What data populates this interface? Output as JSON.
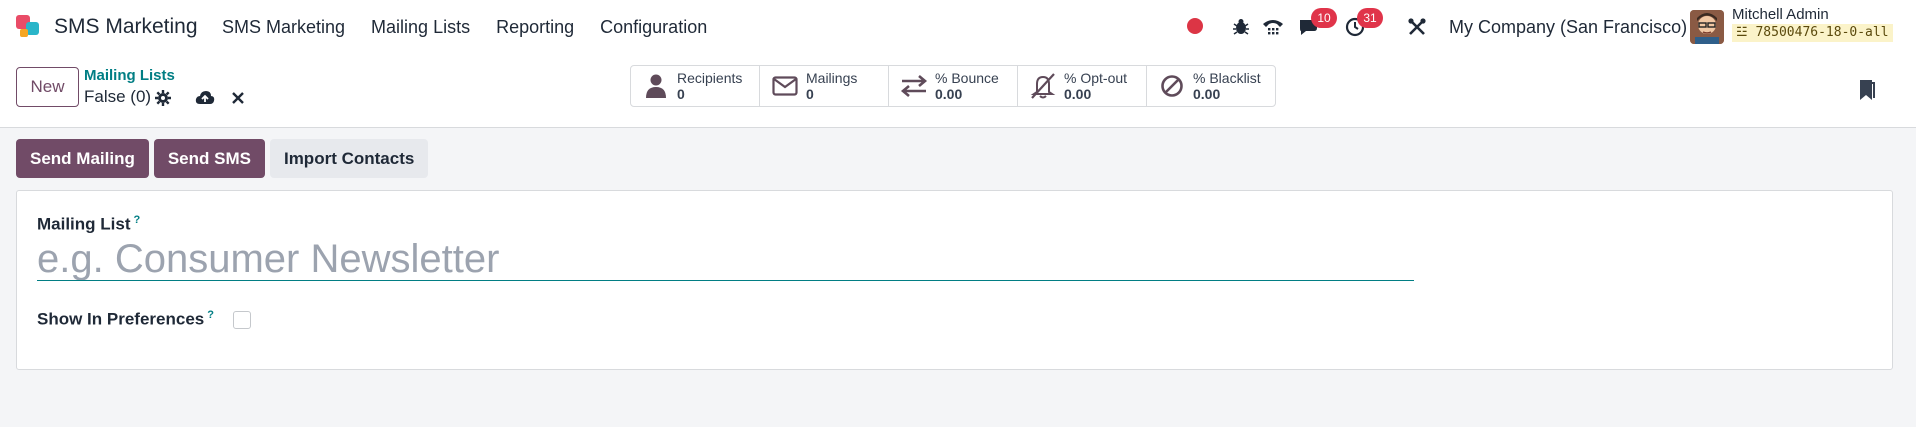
{
  "navbar": {
    "app_name": "SMS Marketing",
    "menu": [
      "SMS Marketing",
      "Mailing Lists",
      "Reporting",
      "Configuration"
    ],
    "chat_badge": "10",
    "activity_badge": "31",
    "company": "My Company (San Francisco)",
    "user_name": "Mitchell Admin",
    "db_name": "78500476-18-0-all",
    "record_color": "#dc3545"
  },
  "control": {
    "new_label": "New",
    "breadcrumb": "Mailing Lists",
    "record_name": "False (0)"
  },
  "stats": [
    {
      "label": "Recipients",
      "value": "0",
      "icon": "user-icon"
    },
    {
      "label": "Mailings",
      "value": "0",
      "icon": "envelope-icon"
    },
    {
      "label": "% Bounce",
      "value": "0.00",
      "icon": "exchange-icon"
    },
    {
      "label": "% Opt-out",
      "value": "0.00",
      "icon": "bell-slash-icon"
    },
    {
      "label": "% Blacklist",
      "value": "0.00",
      "icon": "ban-icon"
    }
  ],
  "actions": {
    "send_mailing": "Send Mailing",
    "send_sms": "Send SMS",
    "import_contacts": "Import Contacts"
  },
  "form": {
    "mailing_list_label": "Mailing List",
    "name_placeholder": "e.g. Consumer Newsletter",
    "name_value": "",
    "show_in_preferences_label": "Show In Preferences",
    "show_in_preferences_checked": false,
    "help_mark": "?"
  },
  "colors": {
    "brand": "#714b67",
    "link": "#017e84",
    "badge": "#e0344a"
  }
}
